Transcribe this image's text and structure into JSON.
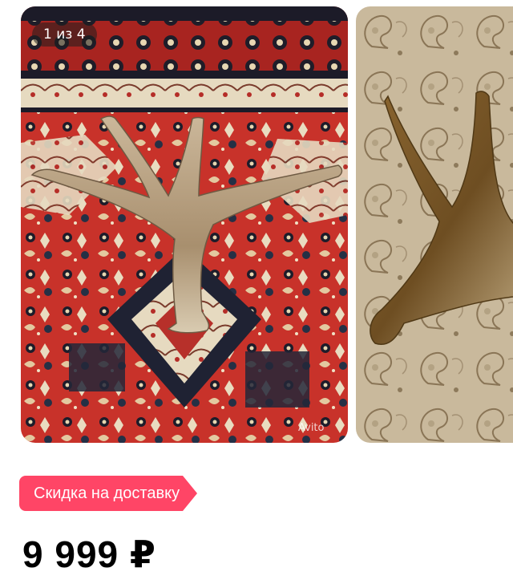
{
  "gallery": {
    "counter": "1 из 4",
    "watermark": "Avito",
    "photos": [
      {
        "subject": "antler-on-red-persian-rug"
      },
      {
        "subject": "antler-on-paisley-fabric"
      }
    ]
  },
  "promo": {
    "label": "Скидка на доставку",
    "color": "#ff4566"
  },
  "listing": {
    "price": "9 999 ₽"
  }
}
